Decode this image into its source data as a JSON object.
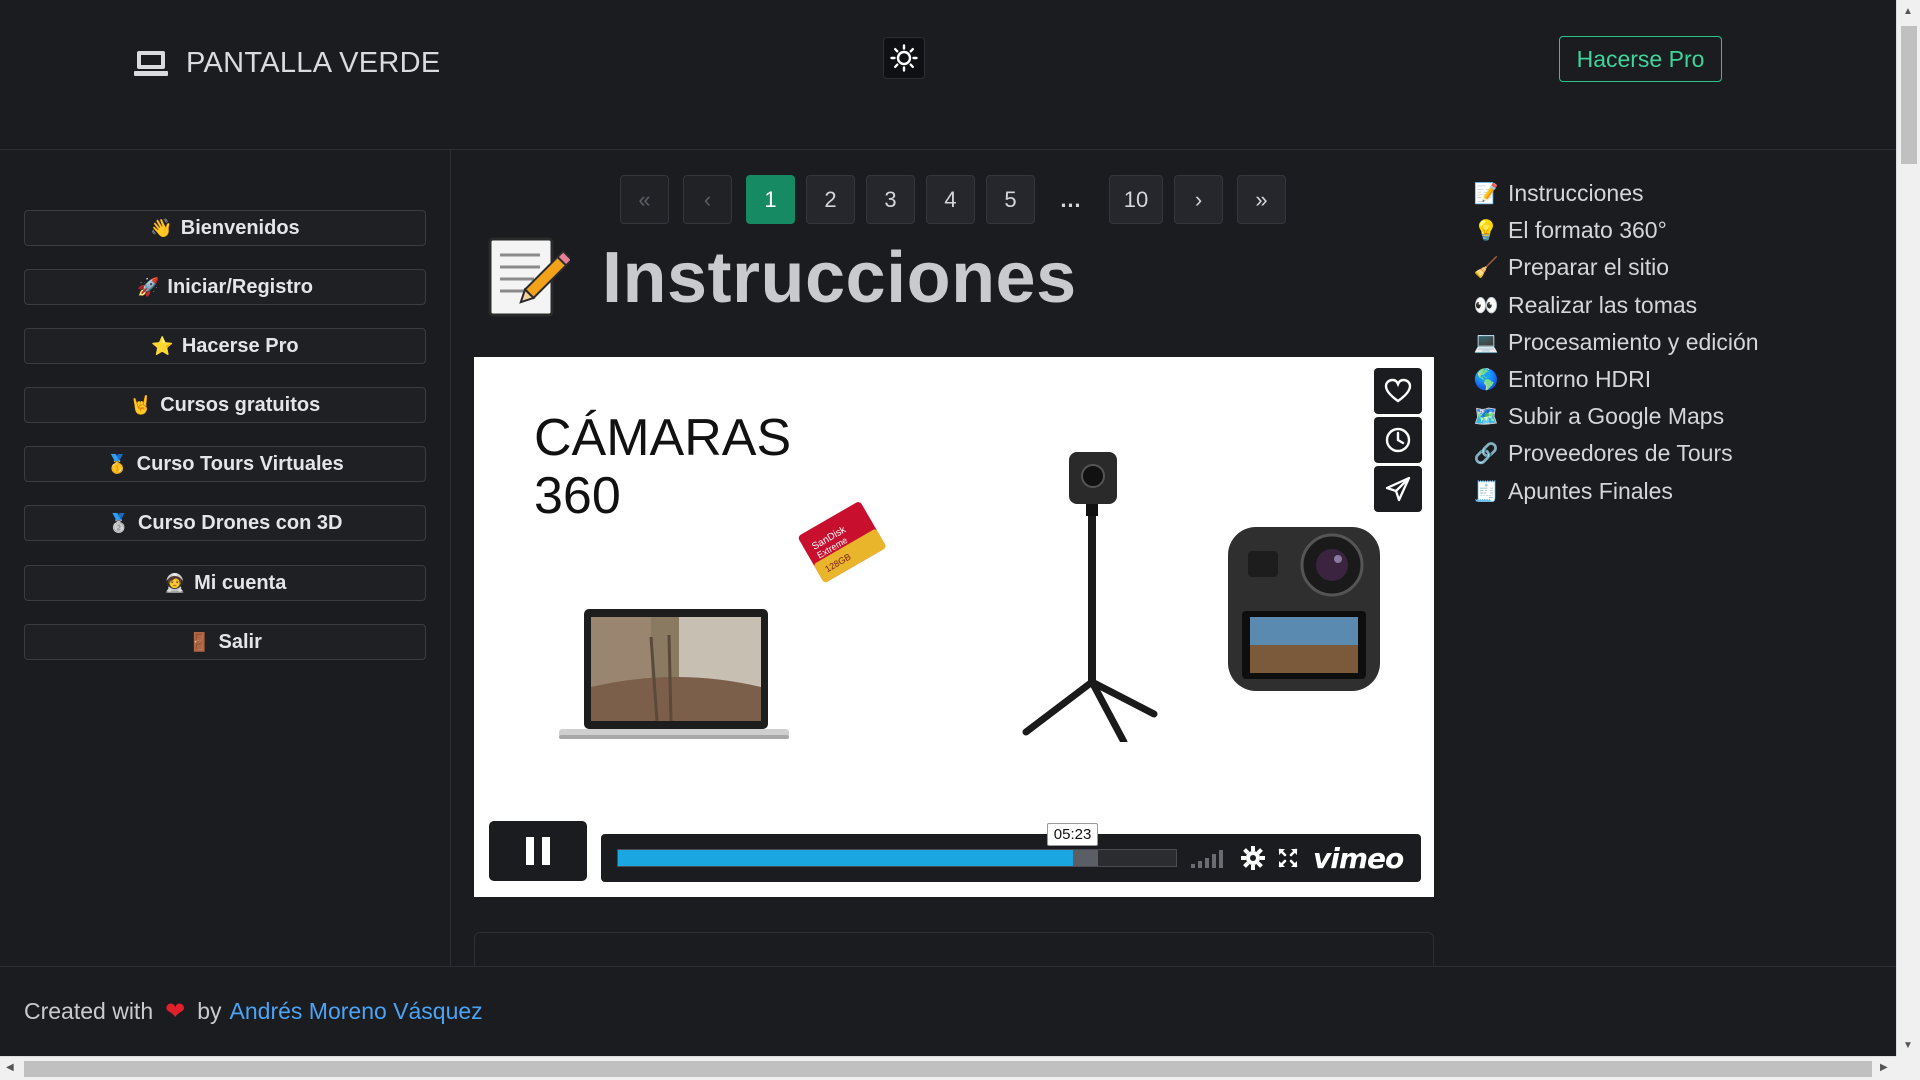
{
  "header": {
    "brand_icon": "laptop-icon",
    "brand_name": "PANTALLA VERDE",
    "theme_icon": "sun-icon",
    "pro_button": "Hacerse Pro",
    "accent_color": "#3fd49a"
  },
  "sidebar": {
    "items": [
      {
        "emoji": "👋",
        "label": "Bienvenidos"
      },
      {
        "emoji": "🚀",
        "label": "Iniciar/Registro"
      },
      {
        "emoji": "⭐",
        "label": "Hacerse Pro"
      },
      {
        "emoji": "🤘",
        "label": "Cursos gratuitos"
      },
      {
        "emoji": "🥇",
        "label": "Curso Tours Virtuales"
      },
      {
        "emoji": "🥈",
        "label": "Curso Drones con 3D"
      },
      {
        "emoji": "🧑‍🚀",
        "label": "Mi cuenta"
      },
      {
        "emoji": "🚪",
        "label": "Salir"
      }
    ]
  },
  "pagination": {
    "first": "«",
    "prev": "‹",
    "pages": [
      "1",
      "2",
      "3",
      "4",
      "5"
    ],
    "ellipsis": "…",
    "last_page": "10",
    "next": "›",
    "last": "»",
    "current": "1"
  },
  "main": {
    "title": "Instrucciones",
    "title_emoji": "📝",
    "video": {
      "heading_line1": "CÁMARAS",
      "heading_line2": "360",
      "current_time": "05:23",
      "progress_fraction": 0.815,
      "buffer_fraction": 0.86,
      "player_brand": "vimeo",
      "side_icons": [
        "heart-icon",
        "clock-icon",
        "send-icon"
      ]
    }
  },
  "toc": {
    "items": [
      {
        "emoji": "📝",
        "label": "Instrucciones"
      },
      {
        "emoji": "💡",
        "label": "El formato 360°"
      },
      {
        "emoji": "🧹",
        "label": "Preparar el sitio"
      },
      {
        "emoji": "👀",
        "label": "Realizar las tomas"
      },
      {
        "emoji": "💻",
        "label": "Procesamiento y edición"
      },
      {
        "emoji": "🌎",
        "label": "Entorno HDRI"
      },
      {
        "emoji": "🗺️",
        "label": "Subir a Google Maps"
      },
      {
        "emoji": "🔗",
        "label": "Proveedores de Tours"
      },
      {
        "emoji": "🧾",
        "label": "Apuntes Finales"
      }
    ]
  },
  "footer": {
    "prefix": "Created with",
    "heart": "❤",
    "by": "by",
    "author": "Andrés Moreno Vásquez"
  }
}
